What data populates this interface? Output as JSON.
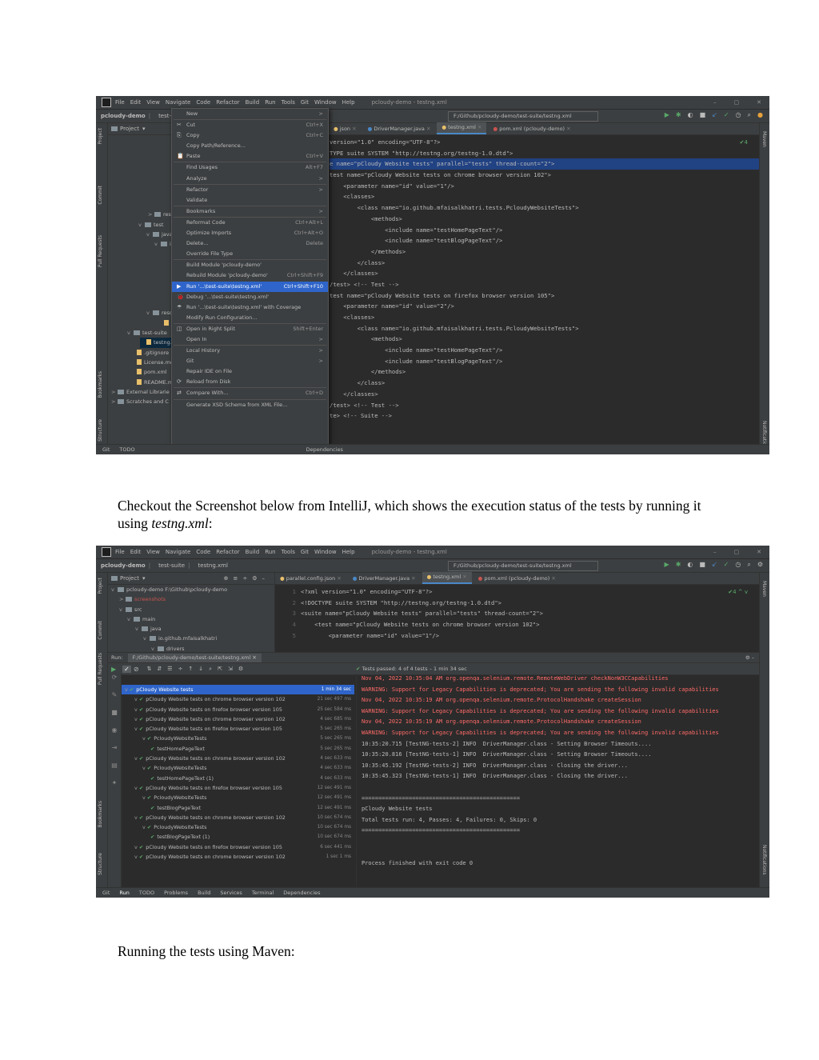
{
  "caption1": {
    "text": "Checkout the Screenshot below from IntelliJ, which shows the execution status of the tests by running it using ",
    "emph": "testng.xml",
    "tail": ":"
  },
  "caption2": {
    "text": "Running the tests using Maven:"
  },
  "shot1": {
    "menu": [
      "File",
      "Edit",
      "View",
      "Navigate",
      "Code",
      "Refactor",
      "Build",
      "Run",
      "Tools",
      "Git",
      "Window",
      "Help"
    ],
    "window_title": "pcloudy-demo - testng.xml",
    "breadcrumb": [
      "pcloudy-demo",
      "test-suit"
    ],
    "run_config": "F:/Github/pcloudy-demo/test-suite/testng.xml",
    "project_label": "Project",
    "tabs": [
      {
        "label": "json",
        "active": false
      },
      {
        "label": "DriverManager.java",
        "active": false
      },
      {
        "label": "testng.xml",
        "active": true
      },
      {
        "label": "pom.xml (pcloudy-demo)",
        "active": false
      }
    ],
    "warning_count": "✔4",
    "tree": [
      {
        "label": "resou",
        "arrow": ">",
        "indent": 50,
        "kind": "folder",
        "row": 9
      },
      {
        "label": "test",
        "arrow": "v",
        "indent": 38,
        "kind": "folder",
        "row": 10
      },
      {
        "label": "java",
        "arrow": "v",
        "indent": 48,
        "kind": "folder",
        "row": 11
      },
      {
        "label": "io.",
        "arrow": "v",
        "indent": 58,
        "kind": "folder",
        "row": 12
      },
      {
        "label": "resou",
        "arrow": "v",
        "indent": 48,
        "kind": "folder",
        "row": 19
      },
      {
        "label": "pa",
        "arrow": "",
        "indent": 62,
        "kind": "file",
        "row": 20
      },
      {
        "label": "test-suite",
        "arrow": "v",
        "indent": 24,
        "kind": "folder",
        "row": 21
      },
      {
        "label": "testng.xn",
        "arrow": "",
        "indent": 40,
        "kind": "file",
        "row": 22
      },
      {
        "label": ".gitignore",
        "arrow": "",
        "indent": 28,
        "kind": "file",
        "row": 23
      },
      {
        "label": "License.md",
        "arrow": "",
        "indent": 28,
        "kind": "file",
        "row": 24
      },
      {
        "label": "pom.xml",
        "arrow": "",
        "indent": 28,
        "kind": "file",
        "row": 25
      },
      {
        "label": "README.md",
        "arrow": "",
        "indent": 28,
        "kind": "file",
        "row": 26
      },
      {
        "label": "External Librarie",
        "arrow": ">",
        "indent": 4,
        "kind": "folder",
        "row": 27
      },
      {
        "label": "Scratches and C",
        "arrow": ">",
        "indent": 4,
        "kind": "folder",
        "row": 28
      }
    ],
    "code_lines": [
      "version=\"1.0\" encoding=\"UTF-8\"?>",
      "TYPE suite SYSTEM \"http://testng.org/testng-1.0.dtd\">",
      "e name=\"pCloudy Website tests\" parallel=\"tests\" thread-count=\"2\">",
      "test name=\"pCloudy Website tests on chrome browser version 102\">",
      "    <parameter name=\"id\" value=\"1\"/>",
      "    <classes>",
      "        <class name=\"io.github.mfaisalkhatri.tests.PcloudyWebsiteTests\">",
      "            <methods>",
      "                <include name=\"testHomePageText\"/>",
      "                <include name=\"testBlogPageText\"/>",
      "            </methods>",
      "        </class>",
      "    </classes>",
      "/test> <!-- Test -->",
      "test name=\"pCloudy Website tests on firefox browser version 105\">",
      "    <parameter name=\"id\" value=\"2\"/>",
      "    <classes>",
      "        <class name=\"io.github.mfaisalkhatri.tests.PcloudyWebsiteTests\">",
      "            <methods>",
      "                <include name=\"testHomePageText\"/>",
      "                <include name=\"testBlogPageText\"/>",
      "            </methods>",
      "        </class>",
      "    </classes>",
      "/test> <!-- Test -->",
      "te> <!-- Suite -->"
    ],
    "context_menu": [
      {
        "label": "New",
        "shortcut": "",
        "arrow": true
      },
      {
        "sep": true
      },
      {
        "label": "Cut",
        "shortcut": "Ctrl+X",
        "icon": "✂"
      },
      {
        "label": "Copy",
        "shortcut": "Ctrl+C",
        "icon": "⎘"
      },
      {
        "label": "Copy Path/Reference...",
        "shortcut": ""
      },
      {
        "label": "Paste",
        "shortcut": "Ctrl+V",
        "icon": "📋"
      },
      {
        "sep": true
      },
      {
        "label": "Find Usages",
        "shortcut": "Alt+F7"
      },
      {
        "label": "Analyze",
        "shortcut": "",
        "arrow": true
      },
      {
        "sep": true
      },
      {
        "label": "Refactor",
        "shortcut": "",
        "arrow": true
      },
      {
        "label": "Validate",
        "shortcut": ""
      },
      {
        "sep": true
      },
      {
        "label": "Bookmarks",
        "shortcut": "",
        "arrow": true
      },
      {
        "sep": true
      },
      {
        "label": "Reformat Code",
        "shortcut": "Ctrl+Alt+L"
      },
      {
        "label": "Optimize Imports",
        "shortcut": "Ctrl+Alt+O"
      },
      {
        "label": "Delete...",
        "shortcut": "Delete"
      },
      {
        "label": "Override File Type",
        "shortcut": ""
      },
      {
        "sep": true
      },
      {
        "label": "Build Module 'pcloudy-demo'",
        "shortcut": ""
      },
      {
        "label": "Rebuild Module 'pcloudy-demo'",
        "shortcut": "Ctrl+Shift+F9"
      },
      {
        "label": "Run '...\\test-suite\\testng.xml'",
        "shortcut": "Ctrl+Shift+F10",
        "icon": "▶",
        "selected": true
      },
      {
        "label": "Debug '...\\test-suite\\testng.xml'",
        "shortcut": "",
        "icon": "🐞"
      },
      {
        "label": "Run '...\\test-suite\\testng.xml' with Coverage",
        "shortcut": "",
        "icon": "☂"
      },
      {
        "label": "Modify Run Configuration...",
        "shortcut": ""
      },
      {
        "sep": true
      },
      {
        "label": "Open in Right Split",
        "shortcut": "Shift+Enter",
        "icon": "◫"
      },
      {
        "label": "Open In",
        "shortcut": "",
        "arrow": true
      },
      {
        "sep": true
      },
      {
        "label": "Local History",
        "shortcut": "",
        "arrow": true
      },
      {
        "label": "Git",
        "shortcut": "",
        "arrow": true
      },
      {
        "label": "Repair IDE on File",
        "shortcut": ""
      },
      {
        "label": "Reload from Disk",
        "shortcut": "",
        "icon": "⟳"
      },
      {
        "sep": true
      },
      {
        "label": "Compare With...",
        "shortcut": "Ctrl+D",
        "icon": "⇄"
      },
      {
        "sep": true
      },
      {
        "label": "Generate XSD Schema from XML File...",
        "shortcut": ""
      }
    ],
    "left_tools": [
      "Project",
      "Commit",
      "Pull Requests",
      "Bookmarks",
      "Structure"
    ],
    "status": [
      "Git",
      "TODO",
      "Dependencies"
    ]
  },
  "shot2": {
    "menu": [
      "File",
      "Edit",
      "View",
      "Navigate",
      "Code",
      "Refactor",
      "Build",
      "Run",
      "Tools",
      "Git",
      "Window",
      "Help"
    ],
    "window_title": "pcloudy-demo - testng.xml",
    "breadcrumb": [
      "pcloudy-demo",
      "test-suite",
      "testng.xml"
    ],
    "run_config": "F:/Github/pcloudy-demo/test-suite/testng.xml",
    "tabs": [
      {
        "label": "parallel.config.json",
        "active": false
      },
      {
        "label": "DriverManager.java",
        "active": false
      },
      {
        "label": "testng.xml",
        "active": true
      },
      {
        "label": "pom.xml (pcloudy-demo)",
        "active": false
      }
    ],
    "project_label": "Project",
    "tree": [
      {
        "label": "pcloudy-demo F:\\Github\\pcloudy-demo",
        "arrow": "v",
        "indent": 4
      },
      {
        "label": "screenshots",
        "arrow": ">",
        "indent": 14
      },
      {
        "label": "src",
        "arrow": "v",
        "indent": 14
      },
      {
        "label": "main",
        "arrow": "v",
        "indent": 24
      },
      {
        "label": "java",
        "arrow": "v",
        "indent": 34
      },
      {
        "label": "io.github.mfaisalkhatri",
        "arrow": "v",
        "indent": 44
      },
      {
        "label": "drivers",
        "arrow": "v",
        "indent": 54
      }
    ],
    "code_lines": [
      {
        "n": "1",
        "t": "<?xml version=\"1.0\" encoding=\"UTF-8\"?>"
      },
      {
        "n": "2",
        "t": "<!DOCTYPE suite SYSTEM \"http://testng.org/testng-1.0.dtd\">"
      },
      {
        "n": "3",
        "t": "<suite name=\"pCloudy Website tests\" parallel=\"tests\" thread-count=\"2\">"
      },
      {
        "n": "4",
        "t": "    <test name=\"pCloudy Website tests on chrome browser version 102\">"
      },
      {
        "n": "5",
        "t": "        <parameter name=\"id\" value=\"1\"/>"
      }
    ],
    "run_label": "Run:",
    "run_tab": "F:/Github/pcloudy-demo/test-suite/testng.xml",
    "tests_passed": "Tests passed: 4 of 4 tests – 1 min 34 sec",
    "results": [
      {
        "label": "pCloudy Website tests",
        "time": "1 min 34 sec",
        "indent": 4,
        "selected": true
      },
      {
        "label": "pCloudy Website tests on chrome browser version 102",
        "time": "21 sec 497 ms",
        "indent": 16
      },
      {
        "label": "pCloudy Website tests on firefox browser version 105",
        "time": "25 sec 584 ms",
        "indent": 16
      },
      {
        "label": "pCloudy Website tests on chrome browser version 102",
        "time": "4 sec 685 ms",
        "indent": 16
      },
      {
        "label": "pCloudy Website tests on firefox browser version 105",
        "time": "5 sec 265 ms",
        "indent": 16
      },
      {
        "label": "PcloudyWebsiteTests",
        "time": "5 sec 265 ms",
        "indent": 26
      },
      {
        "label": "testHomePageText",
        "time": "5 sec 265 ms",
        "indent": 36
      },
      {
        "label": "pCloudy Website tests on chrome browser version 102",
        "time": "4 sec 633 ms",
        "indent": 16
      },
      {
        "label": "PcloudyWebsiteTests",
        "time": "4 sec 633 ms",
        "indent": 26
      },
      {
        "label": "testHomePageText (1)",
        "time": "4 sec 633 ms",
        "indent": 36
      },
      {
        "label": "pCloudy Website tests on firefox browser version 105",
        "time": "12 sec 491 ms",
        "indent": 16
      },
      {
        "label": "PcloudyWebsiteTests",
        "time": "12 sec 491 ms",
        "indent": 26
      },
      {
        "label": "testBlogPageText",
        "time": "12 sec 491 ms",
        "indent": 36
      },
      {
        "label": "pCloudy Website tests on chrome browser version 102",
        "time": "10 sec 674 ms",
        "indent": 16
      },
      {
        "label": "PcloudyWebsiteTests",
        "time": "10 sec 674 ms",
        "indent": 26
      },
      {
        "label": "testBlogPageText (1)",
        "time": "10 sec 674 ms",
        "indent": 36
      },
      {
        "label": "pCloudy Website tests on firefox browser version 105",
        "time": "6 sec 441 ms",
        "indent": 16
      },
      {
        "label": "pCloudy Website tests on chrome browser version 102",
        "time": "1 sec 1 ms",
        "indent": 16
      }
    ],
    "console": [
      {
        "t": "Nov 04, 2022 10:35:04 AM org.openqa.selenium.remote.RemoteWebDriver checkNonW3CCapabilities",
        "warn": true
      },
      {
        "t": "WARNING: Support for Legacy Capabilities is deprecated; You are sending the following invalid capabilities",
        "warn": true
      },
      {
        "t": "Nov 04, 2022 10:35:19 AM org.openqa.selenium.remote.ProtocolHandshake createSession",
        "warn": true
      },
      {
        "t": "WARNING: Support for Legacy Capabilities is deprecated; You are sending the following invalid capabilities",
        "warn": true
      },
      {
        "t": "Nov 04, 2022 10:35:19 AM org.openqa.selenium.remote.ProtocolHandshake createSession",
        "warn": true
      },
      {
        "t": "WARNING: Support for Legacy Capabilities is deprecated; You are sending the following invalid capabilities",
        "warn": true
      },
      {
        "t": "10:35:20.715 [TestNG-tests-2] INFO  DriverManager.class - Setting Browser Timeouts....",
        "warn": false
      },
      {
        "t": "10:35:20.816 [TestNG-tests-1] INFO  DriverManager.class - Setting Browser Timeouts....",
        "warn": false
      },
      {
        "t": "10:35:45.192 [TestNG-tests-2] INFO  DriverManager.class - Closing the driver...",
        "warn": false
      },
      {
        "t": "10:35:45.323 [TestNG-tests-1] INFO  DriverManager.class - Closing the driver...",
        "warn": false
      },
      {
        "t": "",
        "warn": false
      },
      {
        "t": "===============================================",
        "warn": false
      },
      {
        "t": "pCloudy Website tests",
        "warn": false
      },
      {
        "t": "Total tests run: 4, Passes: 4, Failures: 0, Skips: 0",
        "warn": false
      },
      {
        "t": "===============================================",
        "warn": false
      },
      {
        "t": "",
        "warn": false
      },
      {
        "t": "",
        "warn": false
      },
      {
        "t": "Process finished with exit code 0",
        "warn": false
      }
    ],
    "status": [
      "Git",
      "Run",
      "TODO",
      "Problems",
      "Build",
      "Services",
      "Terminal",
      "Dependencies"
    ],
    "left_tools": [
      "Project",
      "Commit",
      "Pull Requests",
      "Bookmarks",
      "Structure"
    ]
  }
}
